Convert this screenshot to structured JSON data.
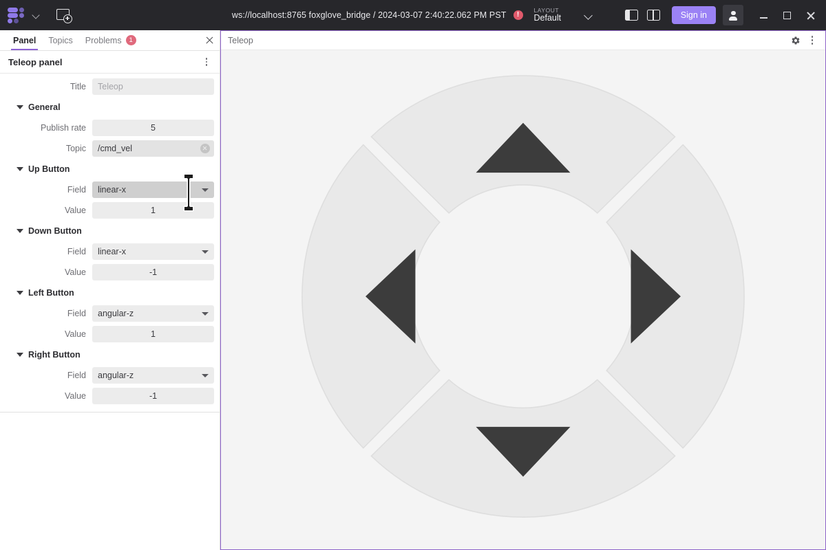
{
  "topbar": {
    "logo_name": "foxglove-logo",
    "logo_chevron": "chevron-down-icon",
    "add_panel_icon": "add-panel-icon",
    "connection_text": "ws://localhost:8765 foxglove_bridge / 2024-03-07 2:40:22.062 PM PST",
    "error_badge": "!",
    "layout_kicker": "LAYOUT",
    "layout_name": "Default",
    "layout_chevron": "chevron-down-icon",
    "left_sidebar_toggle": "left-sidebar-toggle-icon",
    "right_sidebar_toggle": "right-sidebar-toggle-icon",
    "sign_in_label": "Sign in",
    "account_icon": "account-avatar-icon",
    "window_minimize": "minimize-icon",
    "window_maximize": "maximize-icon",
    "window_close": "close-icon",
    "accent_purple": "#9b82f5",
    "bar_background": "#27272b"
  },
  "sidebar": {
    "tabs": [
      {
        "label": "Panel",
        "active": true
      },
      {
        "label": "Topics",
        "active": false
      },
      {
        "label": "Problems",
        "active": false,
        "badge": "1"
      }
    ],
    "close_icon": "close-icon",
    "panel_header": {
      "title": "Teleop panel",
      "menu_icon": "more-vertical-icon"
    },
    "rows": [
      {
        "label": "Title",
        "value": "Teleop",
        "placeholder": true,
        "type": "text",
        "align": "left"
      }
    ],
    "sections": [
      {
        "name": "General",
        "caret": "caret-down-icon",
        "rows": [
          {
            "label": "Publish rate",
            "value": "5",
            "type": "number",
            "align": "center"
          },
          {
            "label": "Topic",
            "value": "/cmd_vel",
            "type": "text",
            "align": "left",
            "clearable": true,
            "hovered": true
          }
        ]
      },
      {
        "name": "Up Button",
        "caret": "caret-down-icon",
        "rows": [
          {
            "label": "Field",
            "value": "linear-x",
            "type": "select",
            "align": "left",
            "hovered": true
          },
          {
            "label": "Value",
            "value": "1",
            "type": "number",
            "align": "center"
          }
        ]
      },
      {
        "name": "Down Button",
        "caret": "caret-down-icon",
        "rows": [
          {
            "label": "Field",
            "value": "linear-x",
            "type": "select",
            "align": "left"
          },
          {
            "label": "Value",
            "value": "-1",
            "type": "number",
            "align": "center"
          }
        ]
      },
      {
        "name": "Left Button",
        "caret": "caret-down-icon",
        "rows": [
          {
            "label": "Field",
            "value": "angular-z",
            "type": "select",
            "align": "left"
          },
          {
            "label": "Value",
            "value": "1",
            "type": "number",
            "align": "center"
          }
        ]
      },
      {
        "name": "Right Button",
        "caret": "caret-down-icon",
        "rows": [
          {
            "label": "Field",
            "value": "angular-z",
            "type": "select",
            "align": "left"
          },
          {
            "label": "Value",
            "value": "-1",
            "type": "number",
            "align": "center"
          }
        ]
      }
    ],
    "cursor": "text-ibeam-cursor"
  },
  "panel": {
    "toolbar_title": "Teleop",
    "settings_icon": "gear-icon",
    "menu_icon": "more-vertical-icon",
    "border_color": "#8d62c9",
    "stage_background": "#f4f4f4",
    "dpad": {
      "button_fill": "#e9e9e9",
      "button_stroke": "#dedede",
      "arrow_color": "#3c3c3c",
      "buttons": [
        {
          "name": "up-button",
          "direction": "up"
        },
        {
          "name": "down-button",
          "direction": "down"
        },
        {
          "name": "left-button",
          "direction": "left"
        },
        {
          "name": "right-button",
          "direction": "right"
        }
      ]
    }
  }
}
